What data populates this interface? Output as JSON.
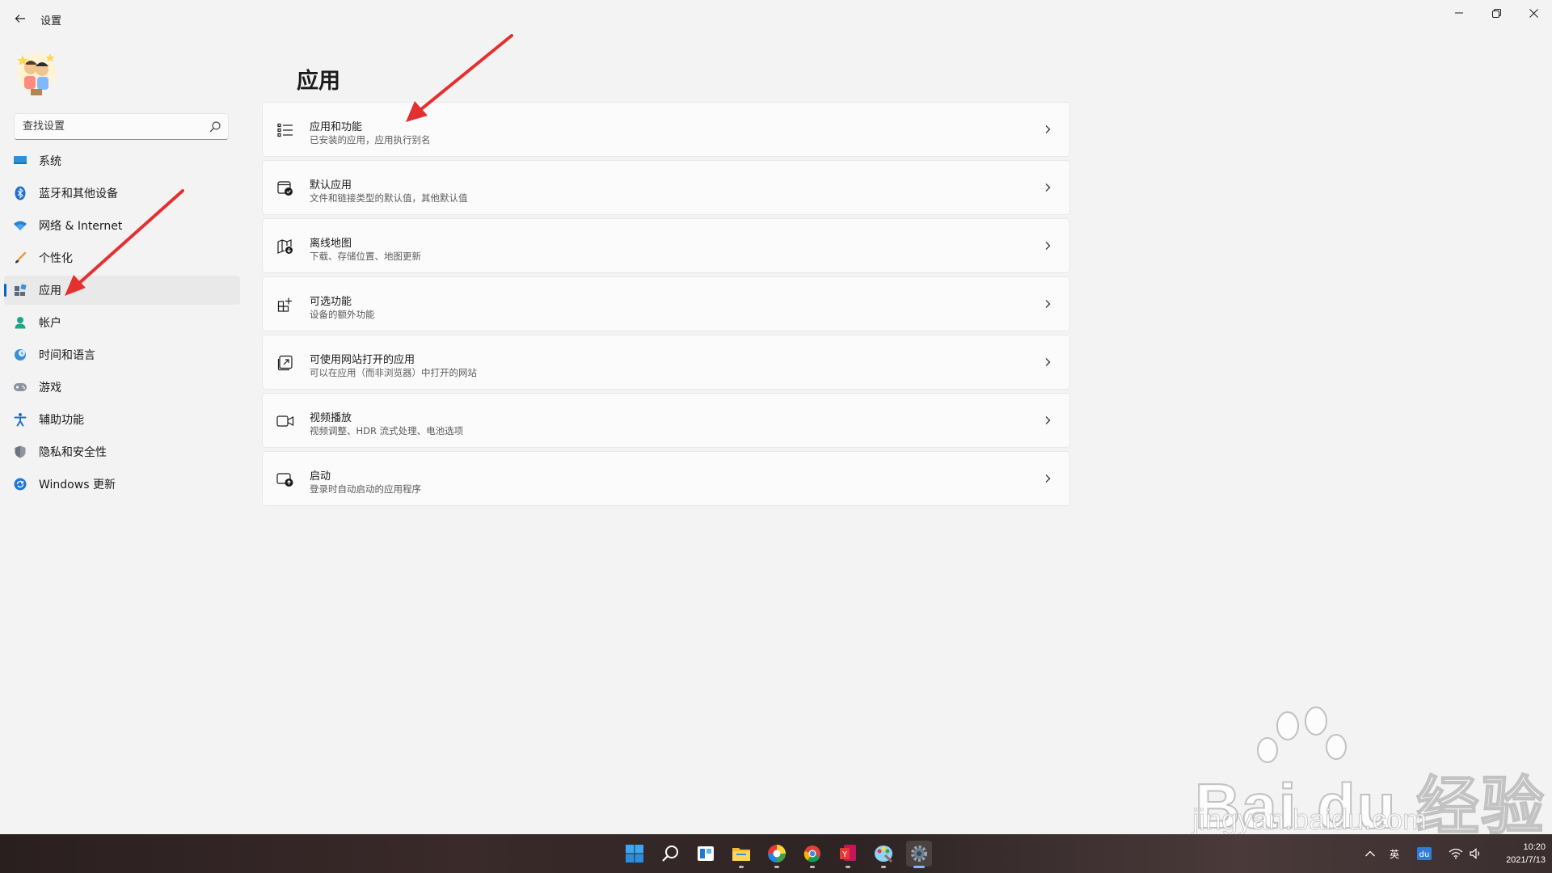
{
  "window": {
    "title": "设置"
  },
  "search": {
    "placeholder": "查找设置"
  },
  "sidebar": {
    "items": [
      {
        "label": "系统",
        "icon": "monitor-icon"
      },
      {
        "label": "蓝牙和其他设备",
        "icon": "bluetooth-icon"
      },
      {
        "label": "网络 & Internet",
        "icon": "wifi-icon"
      },
      {
        "label": "个性化",
        "icon": "brush-icon"
      },
      {
        "label": "应用",
        "icon": "apps-icon",
        "active": true
      },
      {
        "label": "帐户",
        "icon": "person-icon"
      },
      {
        "label": "时间和语言",
        "icon": "globe-clock-icon"
      },
      {
        "label": "游戏",
        "icon": "gamepad-icon"
      },
      {
        "label": "辅助功能",
        "icon": "accessibility-icon"
      },
      {
        "label": "隐私和安全性",
        "icon": "shield-icon"
      },
      {
        "label": "Windows 更新",
        "icon": "update-icon"
      }
    ]
  },
  "main": {
    "title": "应用",
    "cards": [
      {
        "title": "应用和功能",
        "subtitle": "已安装的应用，应用执行别名",
        "icon": "list-icon"
      },
      {
        "title": "默认应用",
        "subtitle": "文件和链接类型的默认值，其他默认值",
        "icon": "default-app-icon"
      },
      {
        "title": "离线地图",
        "subtitle": "下载、存储位置、地图更新",
        "icon": "map-icon"
      },
      {
        "title": "可选功能",
        "subtitle": "设备的额外功能",
        "icon": "add-feature-icon"
      },
      {
        "title": "可使用网站打开的应用",
        "subtitle": "可以在应用（而非浏览器）中打开的网站",
        "icon": "open-external-icon"
      },
      {
        "title": "视频播放",
        "subtitle": "视频调整、HDR 流式处理、电池选项",
        "icon": "video-icon"
      },
      {
        "title": "启动",
        "subtitle": "登录时自动启动的应用程序",
        "icon": "startup-icon"
      }
    ]
  },
  "watermark": {
    "brand": "Bai du 经验",
    "url": "jingyan.baidu.com"
  },
  "taskbar": {
    "apps": [
      "windows-start-icon",
      "search-icon",
      "widgets-icon",
      "file-explorer-icon",
      "colorful-app-icon",
      "chrome-icon",
      "office-app-icon",
      "paint-app-icon",
      "settings-icon"
    ],
    "tray": {
      "ime": "英",
      "time": "10:20",
      "date": "2021/7/13"
    }
  },
  "colors": {
    "accent": "#0067c0",
    "annotation_arrow": "#e53030"
  }
}
